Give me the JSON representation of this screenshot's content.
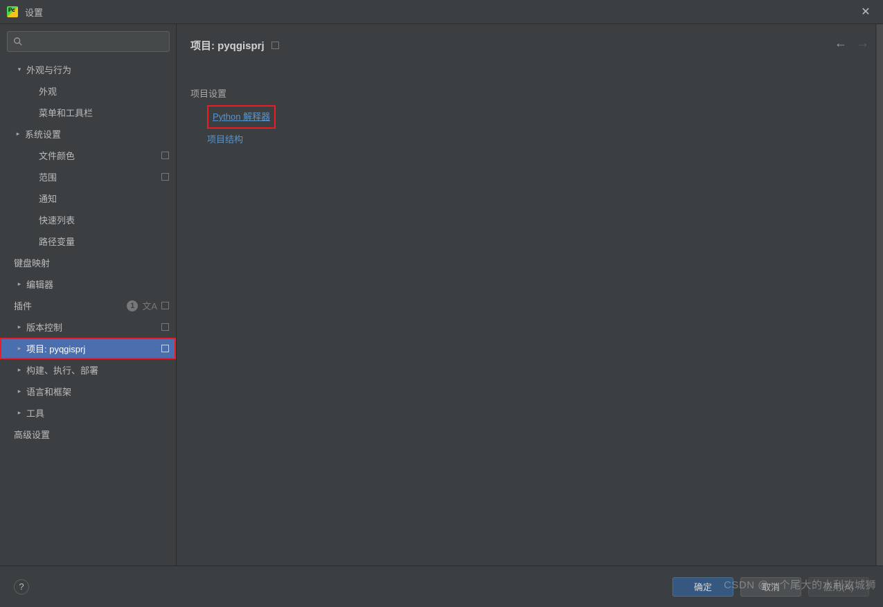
{
  "window": {
    "title": "设置"
  },
  "search": {
    "placeholder": ""
  },
  "sidebar": {
    "items": [
      {
        "label": "外观与行为",
        "depth": 0,
        "arrow": "down"
      },
      {
        "label": "外观",
        "depth": 2
      },
      {
        "label": "菜单和工具栏",
        "depth": 2
      },
      {
        "label": "系统设置",
        "depth": 1,
        "arrow": "right"
      },
      {
        "label": "文件颜色",
        "depth": 2,
        "square": true
      },
      {
        "label": "范围",
        "depth": 2,
        "square": true
      },
      {
        "label": "通知",
        "depth": 2
      },
      {
        "label": "快速列表",
        "depth": 2
      },
      {
        "label": "路径变量",
        "depth": 2
      },
      {
        "label": "键盘映射",
        "depth": 0
      },
      {
        "label": "编辑器",
        "depth": 0,
        "arrow": "right"
      },
      {
        "label": "插件",
        "depth": 0,
        "badge": "1",
        "lang": true,
        "square": true
      },
      {
        "label": "版本控制",
        "depth": 0,
        "arrow": "right",
        "square": true
      },
      {
        "label": "项目: pyqgisprj",
        "depth": 0,
        "arrow": "right",
        "square": true,
        "selected": true,
        "redbox": true
      },
      {
        "label": "构建、执行、部署",
        "depth": 0,
        "arrow": "right"
      },
      {
        "label": "语言和框架",
        "depth": 0,
        "arrow": "right"
      },
      {
        "label": "工具",
        "depth": 0,
        "arrow": "right"
      },
      {
        "label": "高级设置",
        "depth": 0
      }
    ]
  },
  "main": {
    "title": "项目: pyqgisprj",
    "section_title": "项目设置",
    "links": [
      {
        "label": "Python 解释器",
        "highlighted": true
      },
      {
        "label": "项目结构",
        "highlighted": false
      }
    ]
  },
  "footer": {
    "help": "?",
    "ok": "确定",
    "cancel": "取消",
    "apply": "应用(A)"
  },
  "watermark": "CSDN @一个尾大的水利攻城狮"
}
